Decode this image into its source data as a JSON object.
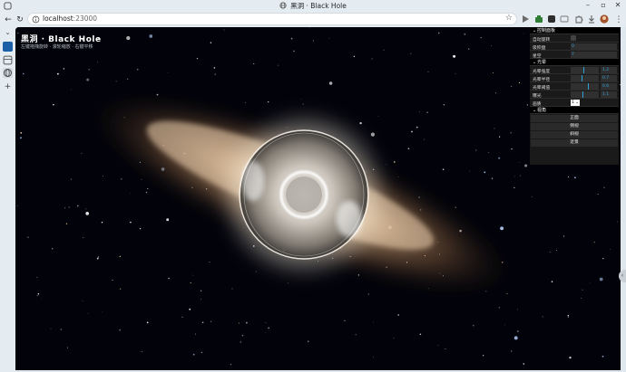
{
  "browser": {
    "tab_title": "黑洞 · Black Hole",
    "url_host": "localhost",
    "url_port": ":23000"
  },
  "overlay": {
    "title": "黑洞 · Black Hole",
    "subtitle": "左键拖拽旋转 · 滚轮缩放 · 右键平移"
  },
  "gui": {
    "folder_main": "控制面板",
    "rows_main": [
      {
        "label": "自动旋转",
        "type": "checkbox",
        "checked": false
      },
      {
        "label": "吸积盘",
        "type": "text",
        "value": "0"
      },
      {
        "label": "星空",
        "type": "text",
        "value": "7"
      }
    ],
    "folder_glow": "光晕",
    "sliders": [
      {
        "label": "光晕强度",
        "value": "1.2",
        "fraction": 0.45
      },
      {
        "label": "光晕半径",
        "value": "0.7",
        "fraction": 0.4
      },
      {
        "label": "光晕阈值",
        "value": "0.6",
        "fraction": 0.62
      },
      {
        "label": "曝光",
        "value": "1.1",
        "fraction": 0.42
      }
    ],
    "quality_label": "画质",
    "quality_value": "1",
    "folder_view": "视角",
    "view_buttons": [
      "正面",
      "侧视",
      "斜视",
      "近景"
    ]
  },
  "colors": {
    "accent": "#2fa1d6",
    "panel_bg": "#1a1a1a",
    "space_bg": "#02030a",
    "disk_warm": "#e6b98a"
  }
}
